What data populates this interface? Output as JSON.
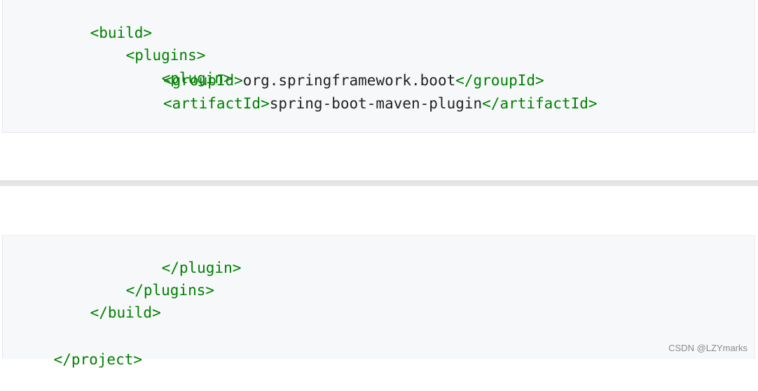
{
  "top_block": {
    "build_open": "<build>",
    "plugins_open": "<plugins>",
    "plugin_open": "<plugin>",
    "group_open": "<groupId>",
    "group_value": "org.springframework.boot",
    "group_close": "</groupId>",
    "artifact_open": "<artifactId>",
    "artifact_value": "spring-boot-maven-plugin",
    "artifact_close": "</artifactId>"
  },
  "bottom_block": {
    "plugin_close": "</plugin>",
    "plugins_close": "</plugins>",
    "build_close": "</build>",
    "project_close": "</project>"
  },
  "watermark": "CSDN @LZYmarks",
  "colors": {
    "tag": "#008000",
    "text": "#222222",
    "code_background": "#f6f8fa"
  }
}
